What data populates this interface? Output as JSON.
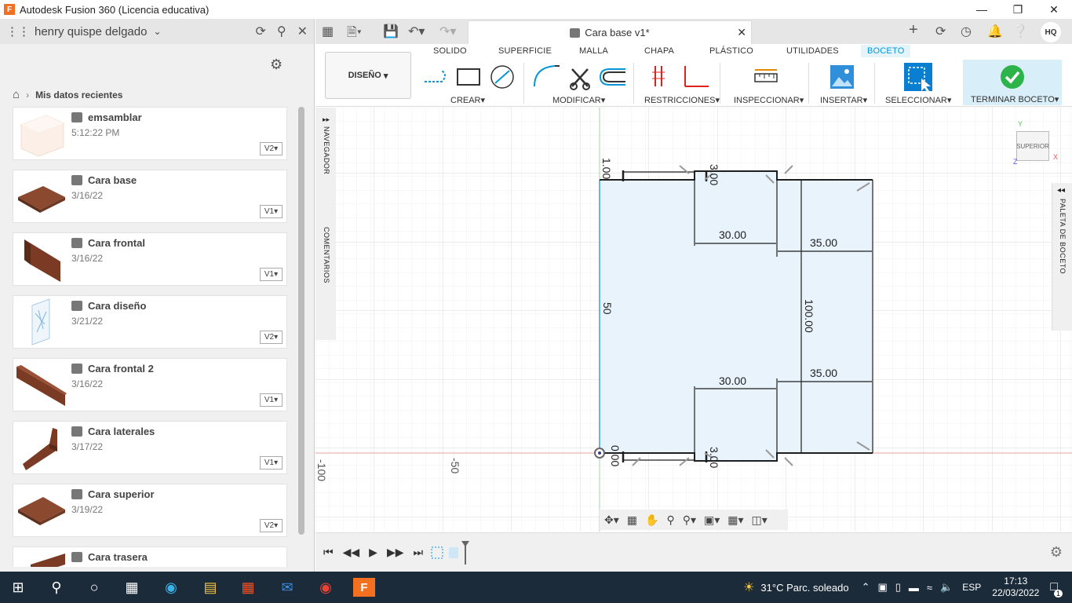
{
  "window": {
    "title": "Autodesk Fusion 360 (Licencia educativa)",
    "logo": "F"
  },
  "data_panel": {
    "user": "henry quispe delgado",
    "breadcrumb": "Mis datos recientes",
    "files": [
      {
        "name": "emsamblar",
        "date": "5:12:22 PM",
        "version": "V2"
      },
      {
        "name": "Cara base",
        "date": "3/16/22",
        "version": "V1"
      },
      {
        "name": "Cara frontal",
        "date": "3/16/22",
        "version": "V1"
      },
      {
        "name": "Cara diseño",
        "date": "3/21/22",
        "version": "V2"
      },
      {
        "name": "Cara frontal 2",
        "date": "3/16/22",
        "version": "V1"
      },
      {
        "name": "Cara laterales",
        "date": "3/17/22",
        "version": "V1"
      },
      {
        "name": "Cara superior",
        "date": "3/19/22",
        "version": "V2"
      },
      {
        "name": "Cara trasera",
        "date": "",
        "version": ""
      }
    ]
  },
  "document": {
    "tab_title": "Cara base v1*",
    "user_initials": "HQ"
  },
  "ribbon": {
    "workspace": "DISEÑO",
    "tabs": [
      "SOLIDO",
      "SUPERFICIE",
      "MALLA",
      "CHAPA",
      "PLÁSTICO",
      "UTILIDADES",
      "BOCETO"
    ],
    "active_tab": "BOCETO",
    "groups": [
      "CREAR",
      "MODIFICAR",
      "RESTRICCIONES",
      "INSPECCIONAR",
      "INSERTAR",
      "SELECCIONAR",
      "TERMINAR BOCETO"
    ]
  },
  "side": {
    "navigator": "NAVEGADOR",
    "comments": "COMENTARIOS",
    "palette": "PALETA DE BOCETO",
    "viewcube": "SUPERIOR"
  },
  "sketch": {
    "dims": {
      "top_small": "1.00",
      "top_small2": "3.00",
      "mid_left_top": "30.00",
      "mid_right_top": "35.00",
      "height": "100.00",
      "left_height": "50",
      "mid_left_bot": "30.00",
      "mid_right_bot": "35.00",
      "bot_small": "0.00",
      "bot_small2": "3.00"
    },
    "axis_labels": {
      "x_minus_100": "-100",
      "x_minus_50": "-50"
    }
  },
  "taskbar": {
    "weather": "31°C  Parc. soleado",
    "lang": "ESP",
    "time": "17:13",
    "date": "22/03/2022",
    "notifications": "1"
  },
  "colors": {
    "accent": "#0696d7",
    "sketch_fill": "#e8f3fb",
    "sketch_line": "#1f1f1f",
    "taskbar": "#1c2b3a",
    "finish_green": "#2cb34a"
  }
}
